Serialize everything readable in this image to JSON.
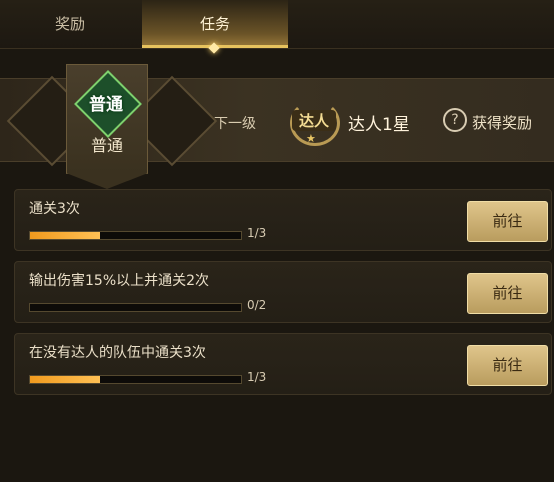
{
  "tabs": [
    {
      "label": "奖励",
      "active": false
    },
    {
      "label": "任务",
      "active": true
    }
  ],
  "rank": {
    "current_badge": "普通",
    "current_name": "普通",
    "next_label": "下一级",
    "next_badge": "达人",
    "next_name": "达人1星"
  },
  "help": {
    "label": "获得奖励",
    "icon": "question-icon"
  },
  "tasks": [
    {
      "title": "通关3次",
      "progress_text": "1/3",
      "progress": 0.333,
      "button": "前往"
    },
    {
      "title": "输出伤害15%以上并通关2次",
      "progress_text": "0/2",
      "progress": 0,
      "button": "前往"
    },
    {
      "title": "在没有达人的队伍中通关3次",
      "progress_text": "1/3",
      "progress": 0.333,
      "button": "前往"
    }
  ],
  "colors": {
    "accent": "#e6c25e",
    "progress": "#f09a1e",
    "button": "#d3b877",
    "badge_green": "#7fd06d"
  }
}
